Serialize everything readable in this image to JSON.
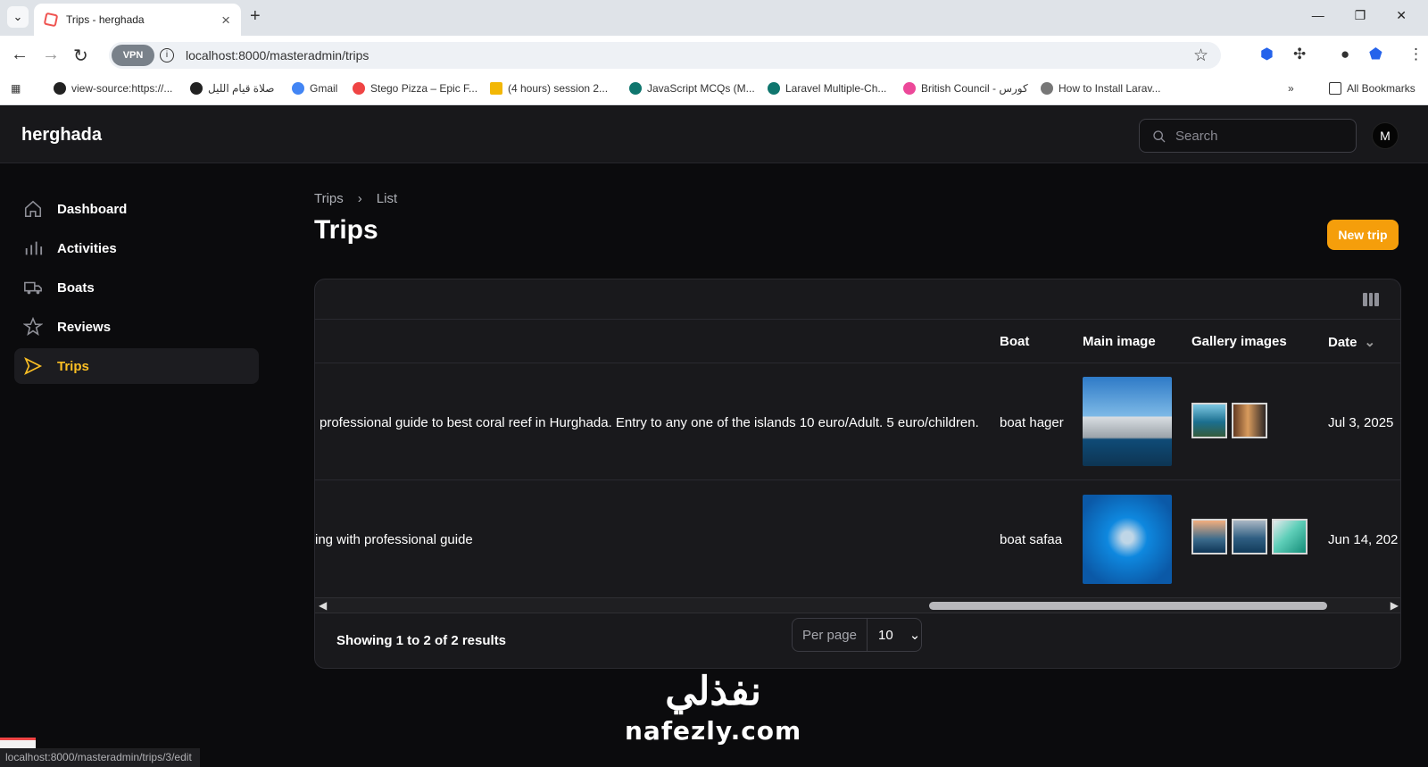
{
  "browser": {
    "tab_title": "Trips - herghada",
    "url": "localhost:8000/masteradmin/trips",
    "vpn": "VPN",
    "bookmarks": [
      "view-source:https://...",
      "صلاة قيام الليل",
      "Gmail",
      "Stego Pizza – Epic F...",
      "(4 hours) session 2...",
      "JavaScript MCQs (M...",
      "Laravel Multiple-Ch...",
      "British Council - كورس",
      "How to Install Larav...",
      "All Bookmarks"
    ]
  },
  "app": {
    "brand": "herghada",
    "search_placeholder": "Search",
    "avatar": "M",
    "nav": [
      {
        "label": "Dashboard",
        "icon": "home-icon"
      },
      {
        "label": "Activities",
        "icon": "bar-chart-icon"
      },
      {
        "label": "Boats",
        "icon": "truck-icon"
      },
      {
        "label": "Reviews",
        "icon": "star-icon"
      },
      {
        "label": "Trips",
        "icon": "paper-plane-icon"
      }
    ],
    "breadcrumb": [
      "Trips",
      "List"
    ],
    "page_title": "Trips",
    "new_button": "New trip"
  },
  "table": {
    "columns": [
      "Boat",
      "Main image",
      "Gallery images",
      "Date"
    ],
    "rows": [
      {
        "description": "professional guide to best coral reef in Hurghada. Entry to any one of the islands 10 euro/Adult. 5 euro/children.",
        "boat": "boat hager",
        "date": "Jul 3, 2025"
      },
      {
        "description": "ing with professional guide",
        "boat": "boat safaa",
        "date": "Jun 14, 202"
      }
    ],
    "summary": "Showing 1 to 2 of 2 results",
    "per_page_label": "Per page",
    "per_page_value": "10"
  },
  "watermark": {
    "arabic": "نفذلي",
    "latin": "nafezly.com"
  },
  "status_url": "localhost:8000/masteradmin/trips/3/edit",
  "colors": {
    "accent": "#f59e0b",
    "background": "#0b0b0d"
  }
}
